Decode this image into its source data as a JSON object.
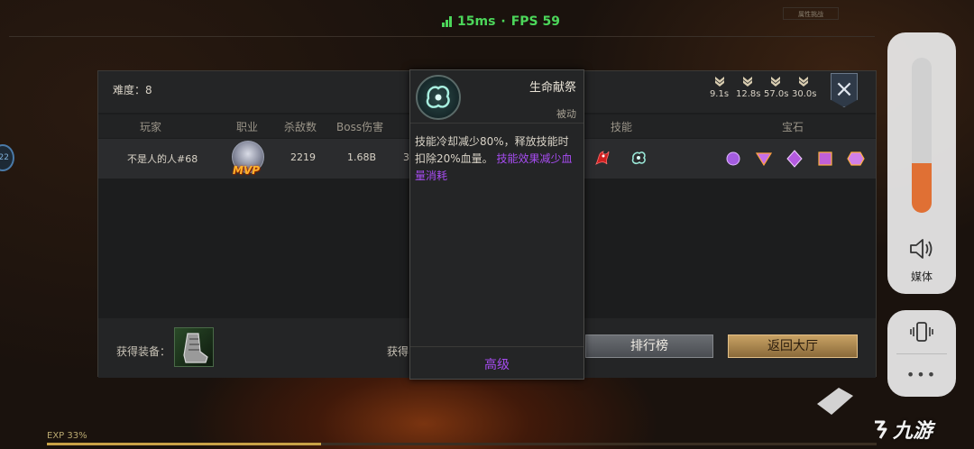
{
  "status": {
    "latency": "15ms",
    "separator": "·",
    "fps": "FPS 59"
  },
  "top_tab": {
    "label": "属性挑战"
  },
  "left_avatar": {
    "badge": "22"
  },
  "panel": {
    "difficulty": "难度：8",
    "rank_times": [
      "9.1s",
      "12.8s",
      "57.0s",
      "30.0s"
    ],
    "columns": [
      "玩家",
      "职业",
      "杀敌数",
      "Boss伤害",
      "技能",
      "宝石"
    ],
    "player": {
      "name": "不是人的人#68",
      "badge": "MVP",
      "kills": "2219",
      "boss_damage": "1.68B",
      "partial": "3"
    },
    "gems": [
      {
        "shape": "circle",
        "color": "#a45ce0"
      },
      {
        "shape": "triangle",
        "color": "#c670e8"
      },
      {
        "shape": "diamond",
        "color": "#b45ae0"
      },
      {
        "shape": "square",
        "color": "#c060d8"
      },
      {
        "shape": "hexagon",
        "color": "#d080e8"
      }
    ],
    "equip_label": "获得装备：",
    "obtain_label": "获得",
    "leaderboard_button": "排行榜",
    "lobby_button": "返回大厅"
  },
  "tooltip": {
    "name": "生命献祭",
    "type": "被动",
    "desc_main": "技能冷却减少80%，释放技能时扣除20%血量。",
    "desc_purple": "技能效果减少血量消耗",
    "grade": "高级"
  },
  "system": {
    "volume_level": 0.32,
    "media_label": "媒体",
    "more": "•••"
  },
  "exp": {
    "label": "EXP 33%",
    "fraction": 0.33
  },
  "watermark": "九游",
  "colors": {
    "accent_gold": "#c8a264",
    "purple": "#a64cf0",
    "fps_green": "#4cd65a",
    "volume_orange": "#e07034"
  }
}
